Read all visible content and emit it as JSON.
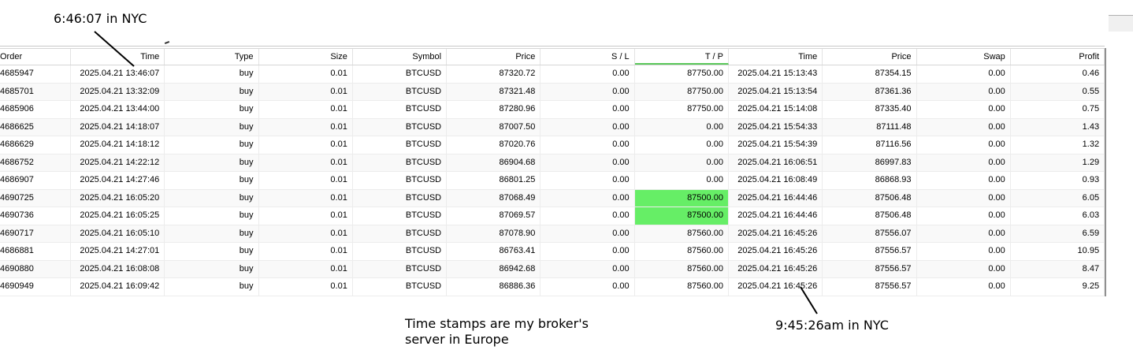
{
  "annotations": {
    "top_left": "6:46:07 in NYC",
    "middle": "Time stamps are my broker's\nserver in Europe",
    "bottom_right": "9:45:26am in NYC"
  },
  "colors": {
    "tp_highlight": "#66ee66",
    "tp_header_underline": "#5ac85a"
  },
  "columns": [
    "Order",
    "Time",
    "Type",
    "Size",
    "Symbol",
    "Price",
    "S / L",
    "T / P",
    "Time",
    "Price",
    "Swap",
    "Profit"
  ],
  "rows": [
    {
      "order": "4685947",
      "open_time": "2025.04.21 13:46:07",
      "type": "buy",
      "size": "0.01",
      "symbol": "BTCUSD",
      "open_price": "87320.72",
      "sl": "0.00",
      "tp": "87750.00",
      "tp_hl": false,
      "close_time": "2025.04.21 15:13:43",
      "close_price": "87354.15",
      "swap": "0.00",
      "profit": "0.46"
    },
    {
      "order": "4685701",
      "open_time": "2025.04.21 13:32:09",
      "type": "buy",
      "size": "0.01",
      "symbol": "BTCUSD",
      "open_price": "87321.48",
      "sl": "0.00",
      "tp": "87750.00",
      "tp_hl": false,
      "close_time": "2025.04.21 15:13:54",
      "close_price": "87361.36",
      "swap": "0.00",
      "profit": "0.55"
    },
    {
      "order": "4685906",
      "open_time": "2025.04.21 13:44:00",
      "type": "buy",
      "size": "0.01",
      "symbol": "BTCUSD",
      "open_price": "87280.96",
      "sl": "0.00",
      "tp": "87750.00",
      "tp_hl": false,
      "close_time": "2025.04.21 15:14:08",
      "close_price": "87335.40",
      "swap": "0.00",
      "profit": "0.75"
    },
    {
      "order": "4686625",
      "open_time": "2025.04.21 14:18:07",
      "type": "buy",
      "size": "0.01",
      "symbol": "BTCUSD",
      "open_price": "87007.50",
      "sl": "0.00",
      "tp": "0.00",
      "tp_hl": false,
      "close_time": "2025.04.21 15:54:33",
      "close_price": "87111.48",
      "swap": "0.00",
      "profit": "1.43"
    },
    {
      "order": "4686629",
      "open_time": "2025.04.21 14:18:12",
      "type": "buy",
      "size": "0.01",
      "symbol": "BTCUSD",
      "open_price": "87020.76",
      "sl": "0.00",
      "tp": "0.00",
      "tp_hl": false,
      "close_time": "2025.04.21 15:54:39",
      "close_price": "87116.56",
      "swap": "0.00",
      "profit": "1.32"
    },
    {
      "order": "4686752",
      "open_time": "2025.04.21 14:22:12",
      "type": "buy",
      "size": "0.01",
      "symbol": "BTCUSD",
      "open_price": "86904.68",
      "sl": "0.00",
      "tp": "0.00",
      "tp_hl": false,
      "close_time": "2025.04.21 16:06:51",
      "close_price": "86997.83",
      "swap": "0.00",
      "profit": "1.29"
    },
    {
      "order": "4686907",
      "open_time": "2025.04.21 14:27:46",
      "type": "buy",
      "size": "0.01",
      "symbol": "BTCUSD",
      "open_price": "86801.25",
      "sl": "0.00",
      "tp": "0.00",
      "tp_hl": false,
      "close_time": "2025.04.21 16:08:49",
      "close_price": "86868.93",
      "swap": "0.00",
      "profit": "0.93"
    },
    {
      "order": "4690725",
      "open_time": "2025.04.21 16:05:20",
      "type": "buy",
      "size": "0.01",
      "symbol": "BTCUSD",
      "open_price": "87068.49",
      "sl": "0.00",
      "tp": "87500.00",
      "tp_hl": true,
      "close_time": "2025.04.21 16:44:46",
      "close_price": "87506.48",
      "swap": "0.00",
      "profit": "6.05"
    },
    {
      "order": "4690736",
      "open_time": "2025.04.21 16:05:25",
      "type": "buy",
      "size": "0.01",
      "symbol": "BTCUSD",
      "open_price": "87069.57",
      "sl": "0.00",
      "tp": "87500.00",
      "tp_hl": true,
      "close_time": "2025.04.21 16:44:46",
      "close_price": "87506.48",
      "swap": "0.00",
      "profit": "6.03"
    },
    {
      "order": "4690717",
      "open_time": "2025.04.21 16:05:10",
      "type": "buy",
      "size": "0.01",
      "symbol": "BTCUSD",
      "open_price": "87078.90",
      "sl": "0.00",
      "tp": "87560.00",
      "tp_hl": false,
      "close_time": "2025.04.21 16:45:26",
      "close_price": "87556.07",
      "swap": "0.00",
      "profit": "6.59"
    },
    {
      "order": "4686881",
      "open_time": "2025.04.21 14:27:01",
      "type": "buy",
      "size": "0.01",
      "symbol": "BTCUSD",
      "open_price": "86763.41",
      "sl": "0.00",
      "tp": "87560.00",
      "tp_hl": false,
      "close_time": "2025.04.21 16:45:26",
      "close_price": "87556.57",
      "swap": "0.00",
      "profit": "10.95"
    },
    {
      "order": "4690880",
      "open_time": "2025.04.21 16:08:08",
      "type": "buy",
      "size": "0.01",
      "symbol": "BTCUSD",
      "open_price": "86942.68",
      "sl": "0.00",
      "tp": "87560.00",
      "tp_hl": false,
      "close_time": "2025.04.21 16:45:26",
      "close_price": "87556.57",
      "swap": "0.00",
      "profit": "8.47"
    },
    {
      "order": "4690949",
      "open_time": "2025.04.21 16:09:42",
      "type": "buy",
      "size": "0.01",
      "symbol": "BTCUSD",
      "open_price": "86886.36",
      "sl": "0.00",
      "tp": "87560.00",
      "tp_hl": false,
      "close_time": "2025.04.21 16:45:26",
      "close_price": "87556.57",
      "swap": "0.00",
      "profit": "9.25"
    }
  ]
}
